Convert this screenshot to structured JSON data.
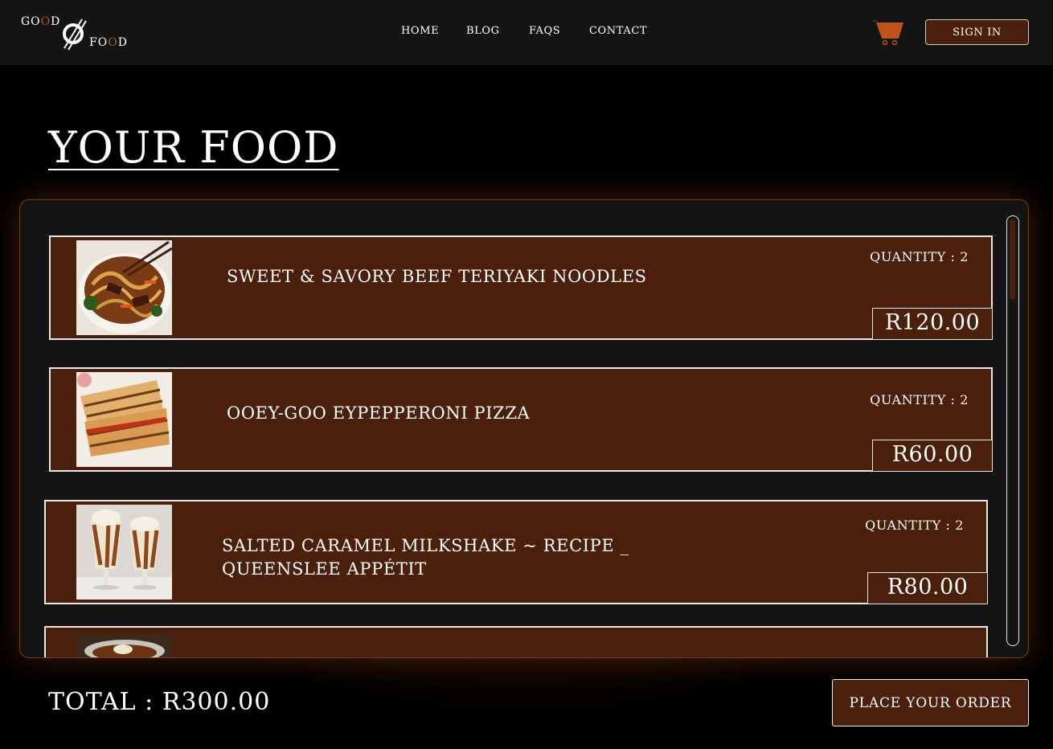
{
  "brand": {
    "logo_top": "GOOD",
    "logo_bottom": "FOOD"
  },
  "nav": {
    "home": "HOME",
    "blog": "BLOG",
    "faqs": "FAQS",
    "contact": "CONTACT",
    "cart_icon": "shopping-cart-icon",
    "signin": "SIGN IN"
  },
  "page": {
    "title": "YOUR FOOD"
  },
  "cart": {
    "items": [
      {
        "name": "SWEET & SAVORY BEEF TERIYAKI NOODLES",
        "quantity": "QUANTITY : 2",
        "price": "R120.00",
        "image": "beef-noodles-photo"
      },
      {
        "name": "OOEY-GOO EYPEPPERONI PIZZA",
        "quantity": "QUANTITY : 2",
        "price": "R60.00",
        "image": "pizza-quesadilla-photo"
      },
      {
        "name": "SALTED CARAMEL MILKSHAKE ~ RECIPE _ QUEENSLEE APPÉTIT",
        "quantity": "QUANTITY : 2",
        "price": "R80.00",
        "image": "milkshake-photo"
      },
      {
        "name": "",
        "quantity": "",
        "price": "",
        "image": "dessert-bowl-photo"
      }
    ],
    "total": "TOTAL : R300.00",
    "order_button": "PLACE YOUR ORDER"
  },
  "colors": {
    "accent": "#4a1f0b",
    "logo_accent": "#c0531a",
    "cart_orange": "#c0531a",
    "panel": "#141414"
  }
}
